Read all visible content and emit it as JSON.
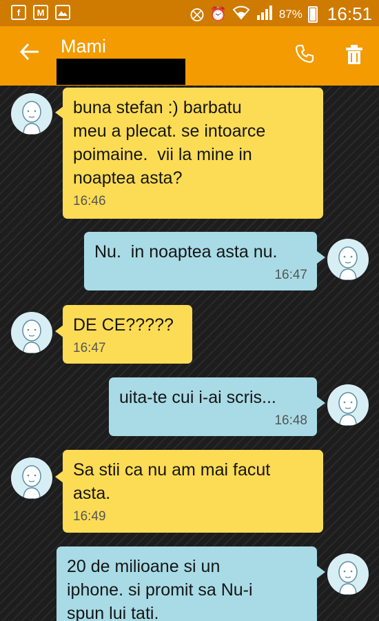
{
  "status_bar": {
    "icons_left": [
      "facebook-icon",
      "gmail-icon",
      "gallery-icon"
    ],
    "icons_right": [
      "mute-icon",
      "alarm-icon",
      "wifi-icon",
      "signal-icon"
    ],
    "battery": "87%",
    "time": "16:51"
  },
  "header": {
    "contact_name": "Mami",
    "number": "",
    "accent": "#f39b00"
  },
  "messages": [
    {
      "direction": "in",
      "text": "buna stefan :) barbatu\nmeu a plecat. se intoarce\npoimaine.  vii la mine in\nnoaptea asta?",
      "time": "16:46"
    },
    {
      "direction": "out",
      "text": "Nu.  in noaptea asta nu.",
      "time": "16:47"
    },
    {
      "direction": "in",
      "text": "DE CE?????",
      "time": "16:47"
    },
    {
      "direction": "out",
      "text": "uita-te cui i-ai scris...",
      "time": "16:48"
    },
    {
      "direction": "in",
      "text": "Sa stii ca nu am mai facut\nasta.",
      "time": "16:49"
    },
    {
      "direction": "out",
      "text": "20 de milioane si un\niphone. si promit sa Nu-i\nspun lui tati.",
      "time": ""
    }
  ],
  "colors": {
    "incoming_bubble": "#fcdc55",
    "outgoing_bubble": "#a8dbe6",
    "status_bar": "#cf7a00"
  }
}
